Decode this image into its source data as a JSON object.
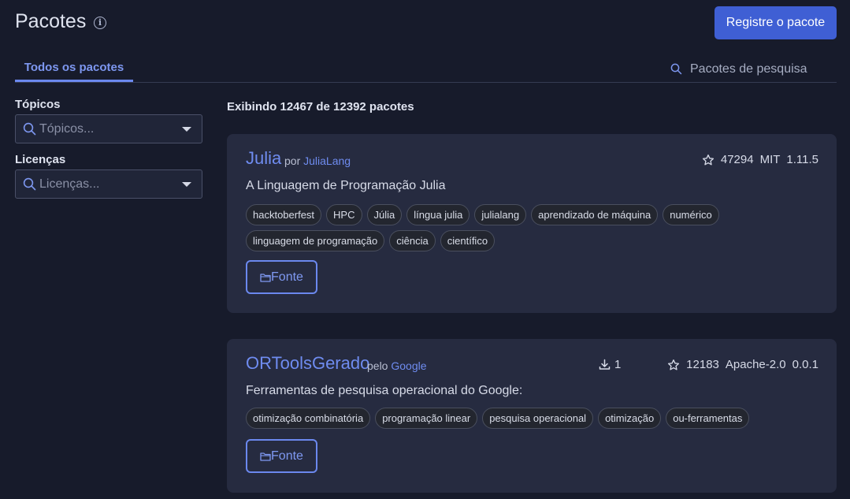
{
  "header": {
    "title": "Pacotes",
    "info_icon": "info-icon",
    "register_label": "Registre o pacote"
  },
  "tabs": [
    {
      "label": "Todos os pacotes",
      "active": true
    }
  ],
  "search": {
    "placeholder": "Pacotes de pesquisa"
  },
  "filters": {
    "topics": {
      "label": "Tópicos",
      "placeholder": "Tópicos..."
    },
    "licenses": {
      "label": "Licenças",
      "placeholder": "Licenças..."
    }
  },
  "results_text": "Exibindo 12467 de 12392 pacotes",
  "packages": [
    {
      "name": "Julia",
      "by_word": "por",
      "owner": "JuliaLang",
      "stars": "47294",
      "license": "MIT",
      "version": "1.11.5",
      "description": "A Linguagem de Programação Julia",
      "tags": [
        "hacktoberfest",
        "HPC",
        "Júlia",
        "língua julia",
        "julialang",
        "aprendizado de máquina",
        "numérico",
        "linguagem de programação",
        "ciência",
        "científico"
      ],
      "source_label": "Fonte"
    },
    {
      "name": "ORToolsGerado",
      "by_word": "pelo",
      "owner": "Google",
      "downloads": "1",
      "stars": "12183",
      "license": "Apache-2.0",
      "version": "0.0.1",
      "description": "Ferramentas de pesquisa operacional do Google:",
      "tags": [
        "otimização combinatória",
        "programação linear",
        "pesquisa operacional",
        "otimização",
        "ou-ferramentas"
      ],
      "source_label": "Fonte"
    }
  ],
  "colors": {
    "background": "#171b2b",
    "card": "#262b40",
    "accent": "#6f8cf0",
    "button": "#3f5fd4"
  }
}
